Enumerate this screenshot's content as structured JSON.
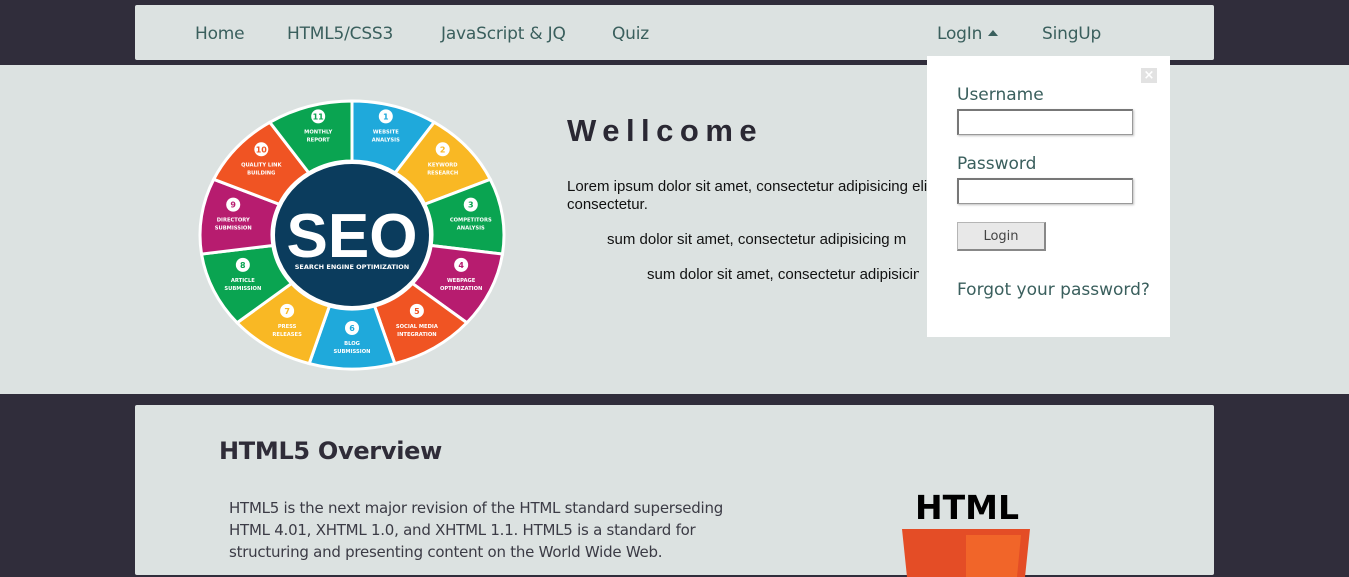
{
  "nav": {
    "items": [
      {
        "label": "Home"
      },
      {
        "label": "HTML5/CSS3"
      },
      {
        "label": "JavaScript & JQ"
      },
      {
        "label": "Quiz"
      }
    ],
    "login_label": "LogIn",
    "signup_label": "SingUp"
  },
  "hero": {
    "title": "Wellcome",
    "paragraphs": [
      "Lorem ipsum dolor sit amet, consectetur adipisicing elit, sed do eiusmod",
      "consectetur.",
      "sum dolor sit amet, consectetur adipisicing m",
      "sum dolor sit amet, consectetur adipisicing"
    ],
    "seo": {
      "center_title": "SEO",
      "center_subtitle": "SEARCH ENGINE OPTIMIZATION",
      "segments": [
        {
          "num": "1",
          "line1": "WEBSITE",
          "line2": "ANALYSIS",
          "color": "#1fa9db"
        },
        {
          "num": "2",
          "line1": "KEYWORD",
          "line2": "RESEARCH",
          "color": "#f9b824"
        },
        {
          "num": "3",
          "line1": "COMPETITORS",
          "line2": "ANALYSIS",
          "color": "#0aa451"
        },
        {
          "num": "4",
          "line1": "WEBPAGE",
          "line2": "OPTIMIZATION",
          "color": "#b71c6f"
        },
        {
          "num": "5",
          "line1": "SOCIAL MEDIA",
          "line2": "INTEGRATION",
          "color": "#f05423"
        },
        {
          "num": "6",
          "line1": "BLOG",
          "line2": "SUBMISSION",
          "color": "#1fa9db"
        },
        {
          "num": "7",
          "line1": "PRESS",
          "line2": "RELEASES",
          "color": "#f9b824"
        },
        {
          "num": "8",
          "line1": "ARTICLE",
          "line2": "SUBMISSION",
          "color": "#0aa451"
        },
        {
          "num": "9",
          "line1": "DIRECTORY",
          "line2": "SUBMISSION",
          "color": "#b71c6f"
        },
        {
          "num": "10",
          "line1": "QUALITY LINK",
          "line2": "BUILDING",
          "color": "#f05423"
        },
        {
          "num": "11",
          "line1": "MONTHLY",
          "line2": "REPORT",
          "color": "#0aa451"
        }
      ],
      "center_color": "#0b3c5d"
    }
  },
  "login_panel": {
    "close_glyph": "×",
    "username_label": "Username",
    "username_value": "",
    "password_label": "Password",
    "password_value": "",
    "button_label": "Login",
    "forgot_label": "Forgot your password?"
  },
  "overview": {
    "title": "HTML5 Overview",
    "body": "HTML5 is the next major revision of the HTML standard superseding HTML 4.01, XHTML 1.0, and XHTML 1.1. HTML5 is a standard for structuring and presenting content on the World Wide Web.",
    "logo_text": "HTML",
    "logo_color": "#e44d26"
  },
  "colors": {
    "dark_bg": "#302d3b",
    "panel_bg": "#dce2e1",
    "link": "#3a5f5d"
  }
}
